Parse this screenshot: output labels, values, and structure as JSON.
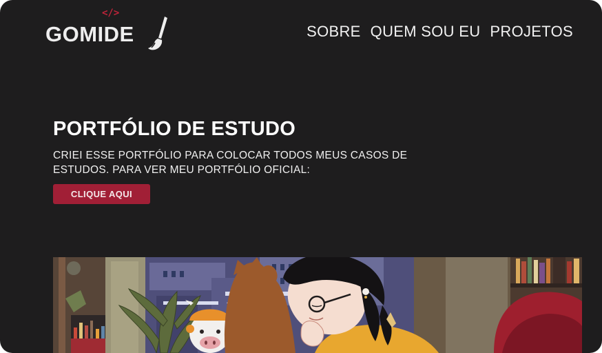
{
  "header": {
    "logo": {
      "text": "GOMIDE",
      "code_glyph": "</>",
      "brush_icon": "paintbrush-icon"
    },
    "nav": [
      {
        "label": "SOBRE"
      },
      {
        "label": "QUEM SOU EU"
      },
      {
        "label": "PROJETOS"
      }
    ]
  },
  "hero": {
    "title": "PORTFÓLIO DE ESTUDO",
    "description": "CRIEI ESSE PORTFÓLIO PARA COLOCAR TODOS MEUS CASOS DE ESTUDOS. PARA VER MEU PORTFÓLIO OFICIAL:",
    "cta_label": "CLIQUE AQUI"
  },
  "colors": {
    "background": "#1e1d1e",
    "accent": "#a11f36",
    "text": "#ffffff"
  }
}
